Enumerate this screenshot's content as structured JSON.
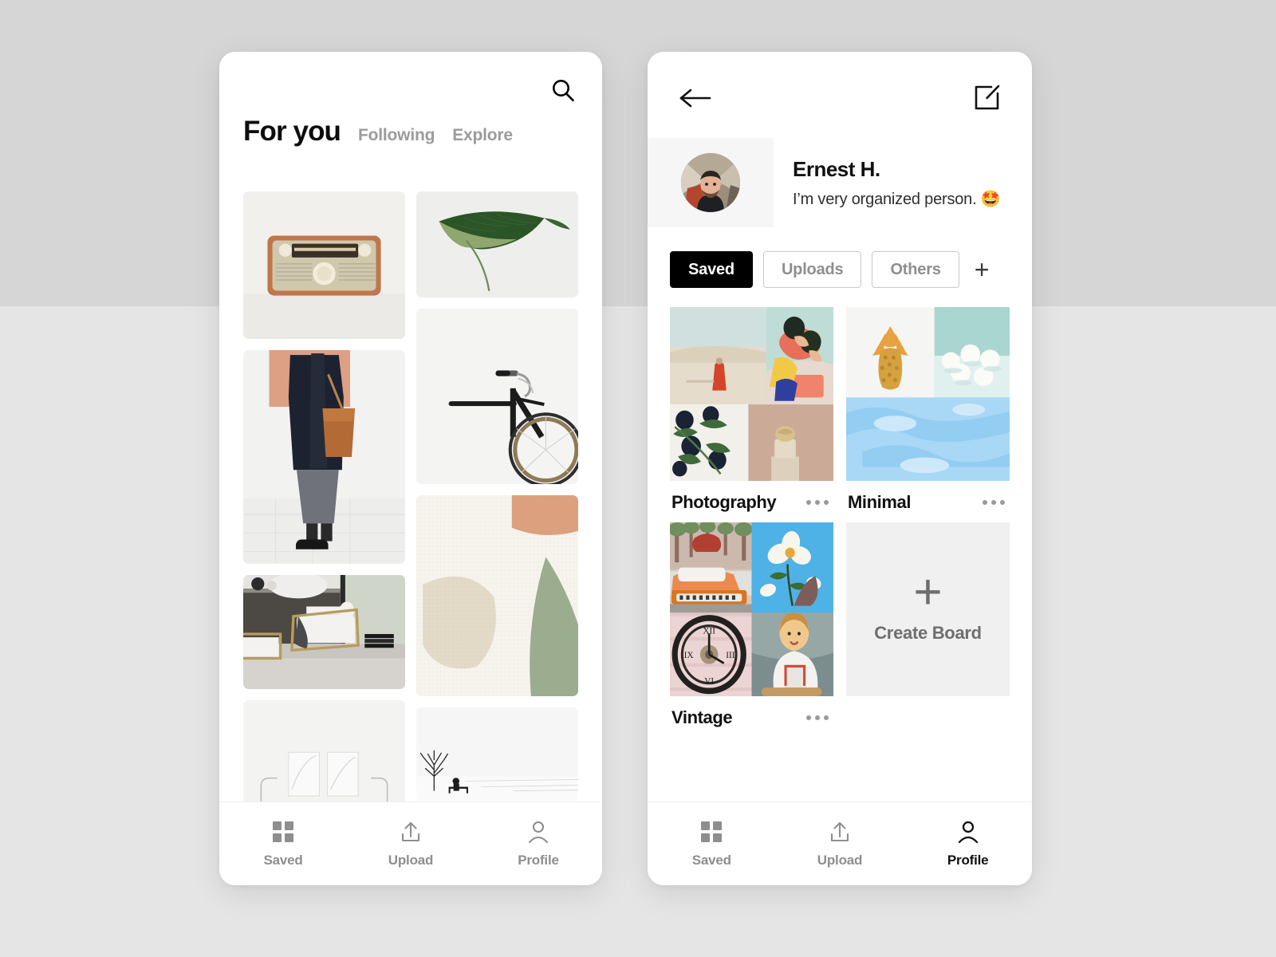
{
  "canvas": {
    "bg_top_color": "#d6d6d6",
    "bg_bottom_color": "#e5e5e5"
  },
  "feed_screen": {
    "search_icon": "search-icon",
    "title": "For you",
    "tabs": [
      {
        "label": "Following"
      },
      {
        "label": "Explore"
      }
    ],
    "grid": {
      "left_column": [
        {
          "name": "vintage-radio-photo"
        },
        {
          "name": "woman-with-tote-bag-photo"
        },
        {
          "name": "modern-armchair-interior-photo"
        },
        {
          "name": "bedroom-wall-art-photo"
        }
      ],
      "right_column": [
        {
          "name": "green-leaf-photo"
        },
        {
          "name": "bicycle-handlebar-photo"
        },
        {
          "name": "abstract-shapes-artwork"
        },
        {
          "name": "winter-tree-bench-photo"
        },
        {
          "name": "blank-placeholder-tile"
        }
      ]
    },
    "navbar": {
      "items": [
        {
          "label": "Saved",
          "icon": "grid-icon",
          "active": false
        },
        {
          "label": "Upload",
          "icon": "upload-icon",
          "active": false
        },
        {
          "label": "Profile",
          "icon": "person-icon",
          "active": false
        }
      ]
    }
  },
  "profile_screen": {
    "back_icon": "arrow-left-icon",
    "edit_icon": "compose-icon",
    "user": {
      "avatar": "user-avatar-photo",
      "name": "Ernest H.",
      "bio": "I’m very organized person. 🤩"
    },
    "filter_pills": [
      {
        "label": "Saved",
        "active": true
      },
      {
        "label": "Uploads",
        "active": false
      },
      {
        "label": "Others",
        "active": false
      }
    ],
    "add_pill": "+",
    "boards": [
      {
        "name": "Photography",
        "menu": "more-options-icon"
      },
      {
        "name": "Minimal",
        "menu": "more-options-icon"
      },
      {
        "name": "Vintage",
        "menu": "more-options-icon"
      }
    ],
    "create_board": {
      "plus": "+",
      "label": "Create Board"
    },
    "navbar": {
      "items": [
        {
          "label": "Saved",
          "icon": "grid-icon",
          "active": false
        },
        {
          "label": "Upload",
          "icon": "upload-icon",
          "active": false
        },
        {
          "label": "Profile",
          "icon": "person-icon",
          "active": true
        }
      ]
    }
  }
}
